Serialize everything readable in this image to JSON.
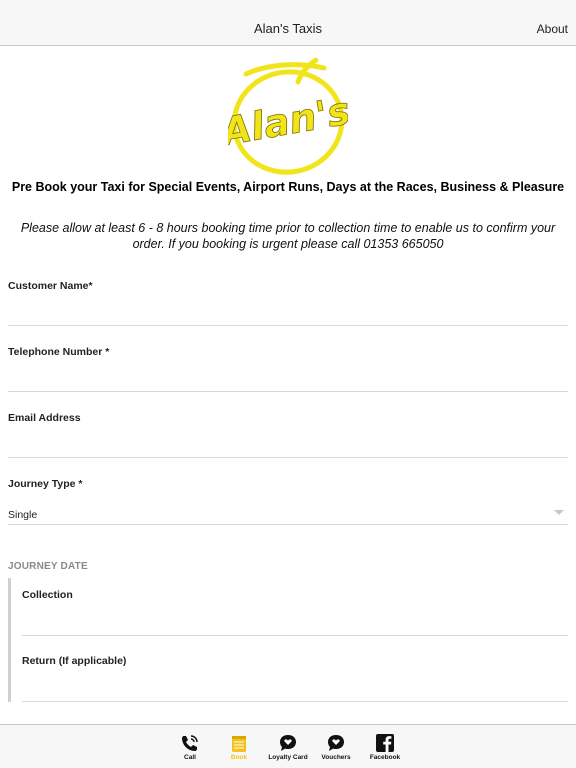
{
  "nav": {
    "title": "Alan's Taxis",
    "right_label": "About"
  },
  "logo": {
    "text": "Alan's",
    "color": "#f2e41a"
  },
  "headline": "Pre Book your Taxi for Special Events, Airport Runs, Days at the Races, Business & Pleasure",
  "notice": "Please allow at least 6 - 8 hours booking time prior to collection time to enable us to confirm your order. If you booking is urgent please call 01353 665050",
  "form": {
    "customer_name": {
      "label": "Customer Name*",
      "value": ""
    },
    "telephone": {
      "label": "Telephone Number *",
      "value": ""
    },
    "email": {
      "label": "Email Address",
      "value": ""
    },
    "journey_type": {
      "label": "Journey Type *",
      "value": "Single"
    },
    "journey_date_header": "JOURNEY DATE",
    "collection": {
      "label": "Collection",
      "value": ""
    },
    "return": {
      "label": "Return (If applicable)",
      "value": ""
    }
  },
  "tabs": [
    {
      "label": "Call",
      "icon": "phone-icon",
      "active": false
    },
    {
      "label": "Book",
      "icon": "notepad-icon",
      "active": true
    },
    {
      "label": "Loyalty Card",
      "icon": "speech-bubble-heart-icon",
      "active": false
    },
    {
      "label": "Vouchers",
      "icon": "speech-bubble-heart-icon",
      "active": false
    },
    {
      "label": "Facebook",
      "icon": "facebook-icon",
      "active": false
    }
  ],
  "colors": {
    "active_tab": "#f5c21b",
    "logo_yellow": "#f2e41a",
    "section_header": "#8a8a8a"
  }
}
